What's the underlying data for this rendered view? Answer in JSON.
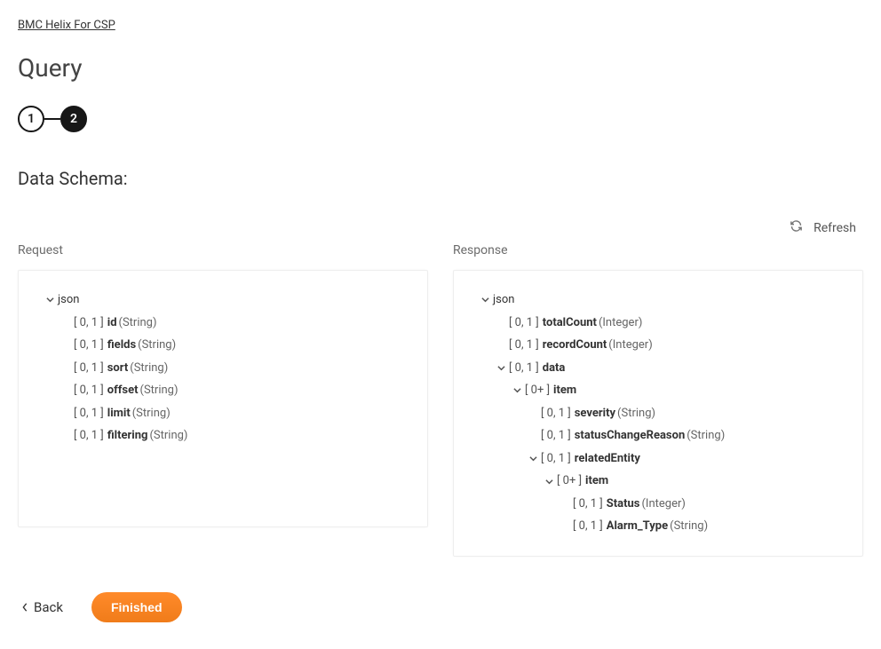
{
  "breadcrumb": "BMC Helix For CSP",
  "title": "Query",
  "stepper": {
    "step1": "1",
    "step2": "2"
  },
  "section_heading": "Data Schema:",
  "refresh_label": "Refresh",
  "request_label": "Request",
  "response_label": "Response",
  "root_json": "json",
  "request_fields": [
    {
      "card": "[ 0, 1 ]",
      "name": "id",
      "type": "(String)"
    },
    {
      "card": "[ 0, 1 ]",
      "name": "fields",
      "type": "(String)"
    },
    {
      "card": "[ 0, 1 ]",
      "name": "sort",
      "type": "(String)"
    },
    {
      "card": "[ 0, 1 ]",
      "name": "offset",
      "type": "(String)"
    },
    {
      "card": "[ 0, 1 ]",
      "name": "limit",
      "type": "(String)"
    },
    {
      "card": "[ 0, 1 ]",
      "name": "filtering",
      "type": "(String)"
    }
  ],
  "response": {
    "totalCount": {
      "card": "[ 0, 1 ]",
      "name": "totalCount",
      "type": "(Integer)"
    },
    "recordCount": {
      "card": "[ 0, 1 ]",
      "name": "recordCount",
      "type": "(Integer)"
    },
    "data": {
      "card": "[ 0, 1 ]",
      "name": "data"
    },
    "item1": {
      "card": "[ 0+ ]",
      "name": "item"
    },
    "severity": {
      "card": "[ 0, 1 ]",
      "name": "severity",
      "type": "(String)"
    },
    "scr": {
      "card": "[ 0, 1 ]",
      "name": "statusChangeReason",
      "type": "(String)"
    },
    "relEnt": {
      "card": "[ 0, 1 ]",
      "name": "relatedEntity"
    },
    "item2": {
      "card": "[ 0+ ]",
      "name": "item"
    },
    "status": {
      "card": "[ 0, 1 ]",
      "name": "Status",
      "type": "(Integer)"
    },
    "alarm": {
      "card": "[ 0, 1 ]",
      "name": "Alarm_Type",
      "type": "(String)"
    }
  },
  "back_label": "Back",
  "finished_label": "Finished"
}
